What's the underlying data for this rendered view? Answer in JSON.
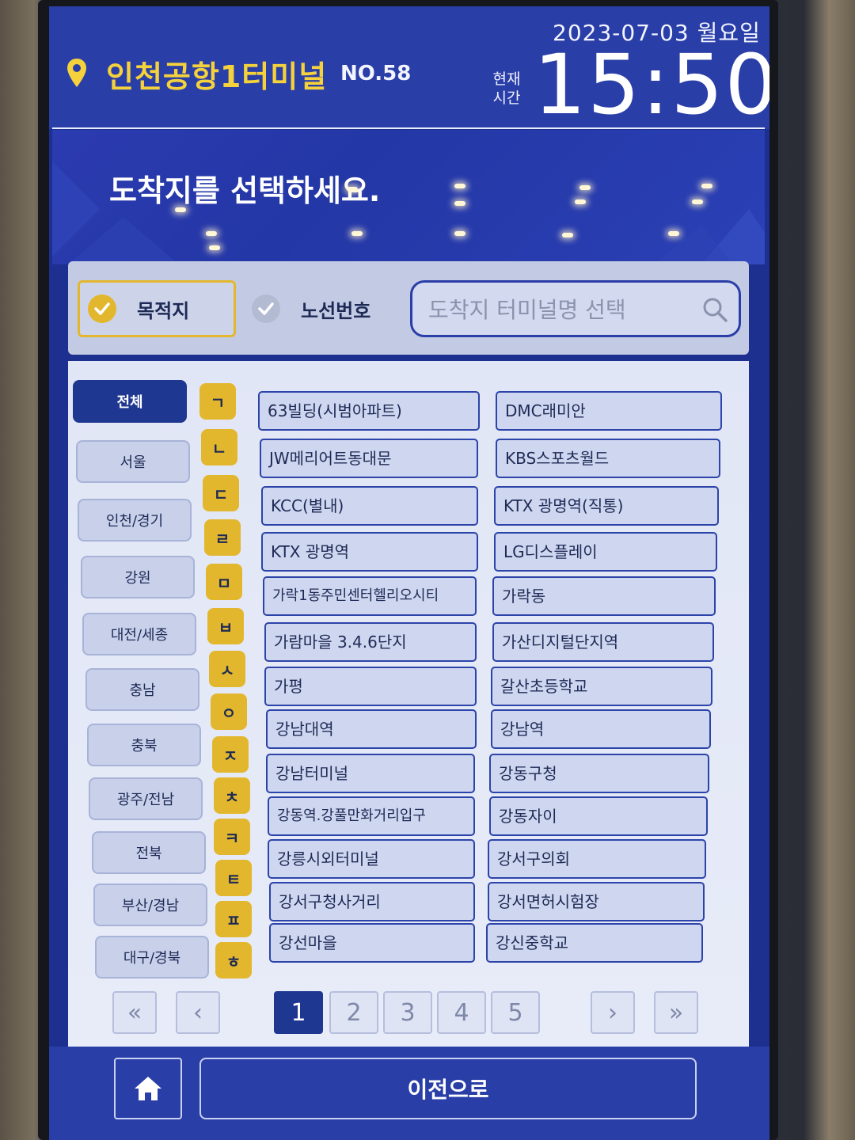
{
  "header": {
    "terminal_name": "인천공항1터미널",
    "kiosk_no": "NO.58",
    "date": "2023-07-03 월요일",
    "now_label": "현재 시간",
    "clock": "15:50"
  },
  "instruction": "도착지를 선택하세요.",
  "filter": {
    "destination_label": "목적지",
    "route_label": "노선번호",
    "search_placeholder": "도착지 터미널명 선택"
  },
  "regions": [
    "전체",
    "서울",
    "인천/경기",
    "강원",
    "대전/세종",
    "충남",
    "충북",
    "광주/전남",
    "전북",
    "부산/경남",
    "대구/경북"
  ],
  "consonants": [
    "ㄱ",
    "ㄴ",
    "ㄷ",
    "ㄹ",
    "ㅁ",
    "ㅂ",
    "ㅅ",
    "ㅇ",
    "ㅈ",
    "ㅊ",
    "ㅋ",
    "ㅌ",
    "ㅍ",
    "ㅎ"
  ],
  "destinations_left": [
    "63빌딩(시범아파트)",
    "JW메리어트동대문",
    "KCC(별내)",
    "KTX 광명역",
    "가락1동주민센터헬리오시티",
    "가람마을 3.4.6단지",
    "가평",
    "강남대역",
    "강남터미널",
    "강동역.강풀만화거리입구",
    "강릉시외터미널",
    "강서구청사거리",
    "강선마을"
  ],
  "destinations_right": [
    "DMC래미안",
    "KBS스포츠월드",
    "KTX 광명역(직통)",
    "LG디스플레이",
    "가락동",
    "가산디지털단지역",
    "갈산초등학교",
    "강남역",
    "강동구청",
    "강동자이",
    "강서구의회",
    "강서면허시험장",
    "강신중학교"
  ],
  "pagination": {
    "first": "«",
    "prev": "‹",
    "pages": [
      "1",
      "2",
      "3",
      "4",
      "5"
    ],
    "current": "1",
    "next": "›",
    "last": "»"
  },
  "bottom": {
    "home_icon": "home-icon",
    "prev_label": "이전으로"
  },
  "colors": {
    "header_blue": "#2a3ea8",
    "accent_yellow": "#e3b72d",
    "active_navy": "#1e3791"
  }
}
